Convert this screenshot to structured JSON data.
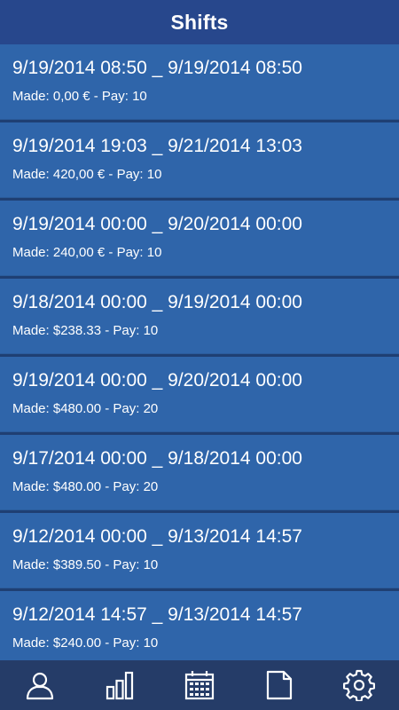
{
  "header": {
    "title": "Shifts"
  },
  "shifts": [
    {
      "range": "9/19/2014 08:50 _ 9/19/2014 08:50",
      "made": "Made: 0,00 € - Pay: 10"
    },
    {
      "range": "9/19/2014 19:03 _ 9/21/2014 13:03",
      "made": "Made: 420,00 € - Pay: 10"
    },
    {
      "range": "9/19/2014 00:00 _ 9/20/2014 00:00",
      "made": "Made: 240,00 € - Pay: 10"
    },
    {
      "range": "9/18/2014 00:00 _ 9/19/2014 00:00",
      "made": "Made: $238.33 - Pay: 10"
    },
    {
      "range": "9/19/2014 00:00 _ 9/20/2014 00:00",
      "made": "Made: $480.00 - Pay: 20"
    },
    {
      "range": "9/17/2014 00:00 _ 9/18/2014 00:00",
      "made": "Made: $480.00 - Pay: 20"
    },
    {
      "range": "9/12/2014 00:00 _ 9/13/2014 14:57",
      "made": "Made: $389.50 - Pay: 10"
    },
    {
      "range": "9/12/2014 14:57 _ 9/13/2014 14:57",
      "made": "Made: $240.00 - Pay: 10"
    }
  ],
  "bottom_nav": [
    {
      "icon": "user-icon"
    },
    {
      "icon": "bar-chart-icon"
    },
    {
      "icon": "calendar-icon"
    },
    {
      "icon": "document-icon"
    },
    {
      "icon": "gear-icon"
    }
  ],
  "colors": {
    "header": "#27478c",
    "row": "#2f65aa",
    "nav": "#253c68",
    "text": "#ffffff"
  }
}
